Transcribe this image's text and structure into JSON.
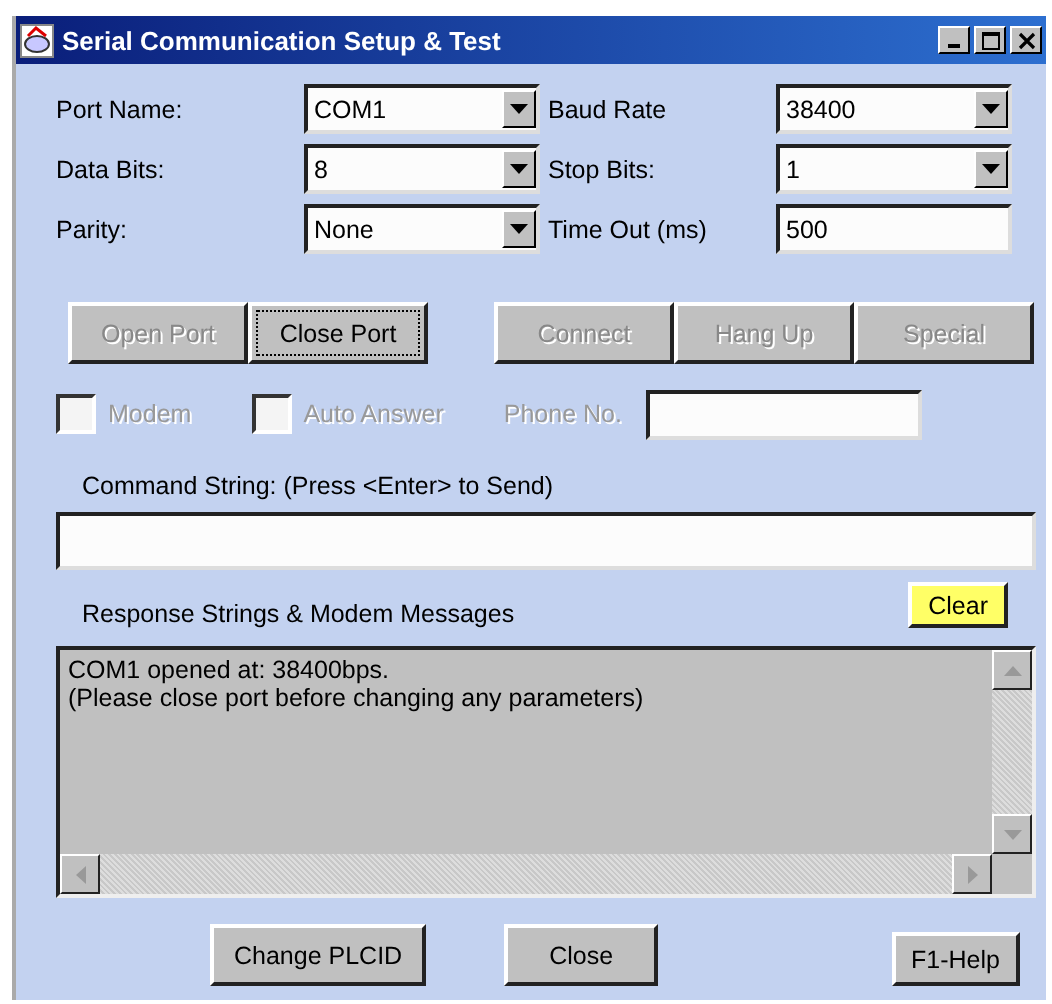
{
  "window": {
    "title": "Serial Communication Setup & Test"
  },
  "settings": [
    {
      "label": "Port Name:",
      "kind": "combo",
      "value": "COM1"
    },
    {
      "label": "Baud Rate",
      "kind": "combo",
      "value": "38400"
    },
    {
      "label": "Data Bits:",
      "kind": "combo",
      "value": "8"
    },
    {
      "label": "Stop Bits:",
      "kind": "combo",
      "value": "1"
    },
    {
      "label": "Parity:",
      "kind": "combo",
      "value": "None"
    },
    {
      "label": "Time Out (ms)",
      "kind": "text",
      "value": "500"
    }
  ],
  "port_buttons": [
    {
      "label": "Open Port",
      "disabled": true,
      "focused": false
    },
    {
      "label": "Close Port",
      "disabled": false,
      "focused": true
    }
  ],
  "modem_buttons": [
    {
      "label": "Connect",
      "disabled": true
    },
    {
      "label": "Hang Up",
      "disabled": true
    },
    {
      "label": "Special",
      "disabled": true
    }
  ],
  "checkboxes": [
    {
      "label": "Modem",
      "checked": false,
      "disabled": true
    },
    {
      "label": "Auto Answer",
      "checked": false,
      "disabled": true
    }
  ],
  "phone": {
    "label": "Phone No.",
    "disabled": true
  },
  "command": {
    "label": "Command String: (Press <Enter> to Send)"
  },
  "response": {
    "label": "Response Strings & Modem Messages",
    "clear_button": "Clear",
    "lines": [
      "COM1 opened at: 38400bps.",
      "(Please close port before changing any parameters)"
    ]
  },
  "footer_buttons": [
    "Change PLCID",
    "Close"
  ],
  "help_button": "F1-Help"
}
